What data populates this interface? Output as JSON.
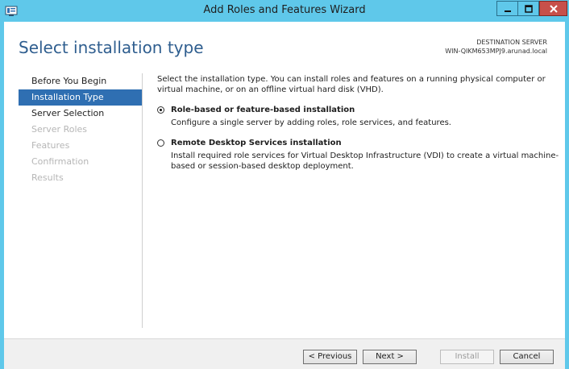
{
  "window": {
    "title": "Add Roles and Features Wizard"
  },
  "header": {
    "page_title": "Select installation type",
    "destination_label": "DESTINATION SERVER",
    "destination_server": "WIN-QIKM653MPJ9.arunad.local"
  },
  "nav": {
    "items": [
      {
        "label": "Before You Begin",
        "state": "normal"
      },
      {
        "label": "Installation Type",
        "state": "active"
      },
      {
        "label": "Server Selection",
        "state": "normal"
      },
      {
        "label": "Server Roles",
        "state": "disabled"
      },
      {
        "label": "Features",
        "state": "disabled"
      },
      {
        "label": "Confirmation",
        "state": "disabled"
      },
      {
        "label": "Results",
        "state": "disabled"
      }
    ]
  },
  "main": {
    "intro": "Select the installation type. You can install roles and features on a running physical computer or virtual machine, or on an offline virtual hard disk (VHD).",
    "options": [
      {
        "label": "Role-based or feature-based installation",
        "description": "Configure a single server by adding roles, role services, and features.",
        "selected": true
      },
      {
        "label": "Remote Desktop Services installation",
        "description": "Install required role services for Virtual Desktop Infrastructure (VDI) to create a virtual machine-based or session-based desktop deployment.",
        "selected": false
      }
    ]
  },
  "footer": {
    "previous_label": "< Previous",
    "next_label": "Next >",
    "install_label": "Install",
    "cancel_label": "Cancel"
  },
  "colors": {
    "title_bar": "#5fc8ea",
    "close_button": "#c7504a",
    "active_nav": "#2f6fb2",
    "page_title": "#2f5e8f"
  },
  "icons": {
    "app": "server-manager-icon",
    "minimize": "minimize-icon",
    "maximize": "maximize-icon",
    "close": "close-icon"
  }
}
